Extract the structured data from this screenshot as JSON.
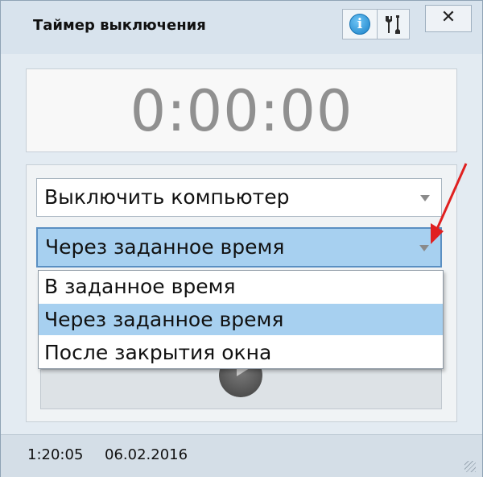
{
  "window": {
    "title": "Таймер выключения",
    "close_label": "✕",
    "info_label": "i"
  },
  "timer": {
    "display": "0:00:00"
  },
  "action_select": {
    "value": "Выключить компьютер"
  },
  "mode_select": {
    "value": "Через заданное время",
    "options": [
      "В заданное время",
      "Через заданное время",
      "После закрытия окна"
    ],
    "selected_index": 1
  },
  "statusbar": {
    "time": "1:20:05",
    "date": "06.02.2016"
  },
  "icons": [
    "info-icon",
    "tools-icon",
    "close-icon",
    "chevron-down-icon",
    "play-icon",
    "resize-grip-icon",
    "annotation-arrow"
  ],
  "colors": {
    "highlight": "#a7d0f0",
    "annotation": "#e02020"
  }
}
